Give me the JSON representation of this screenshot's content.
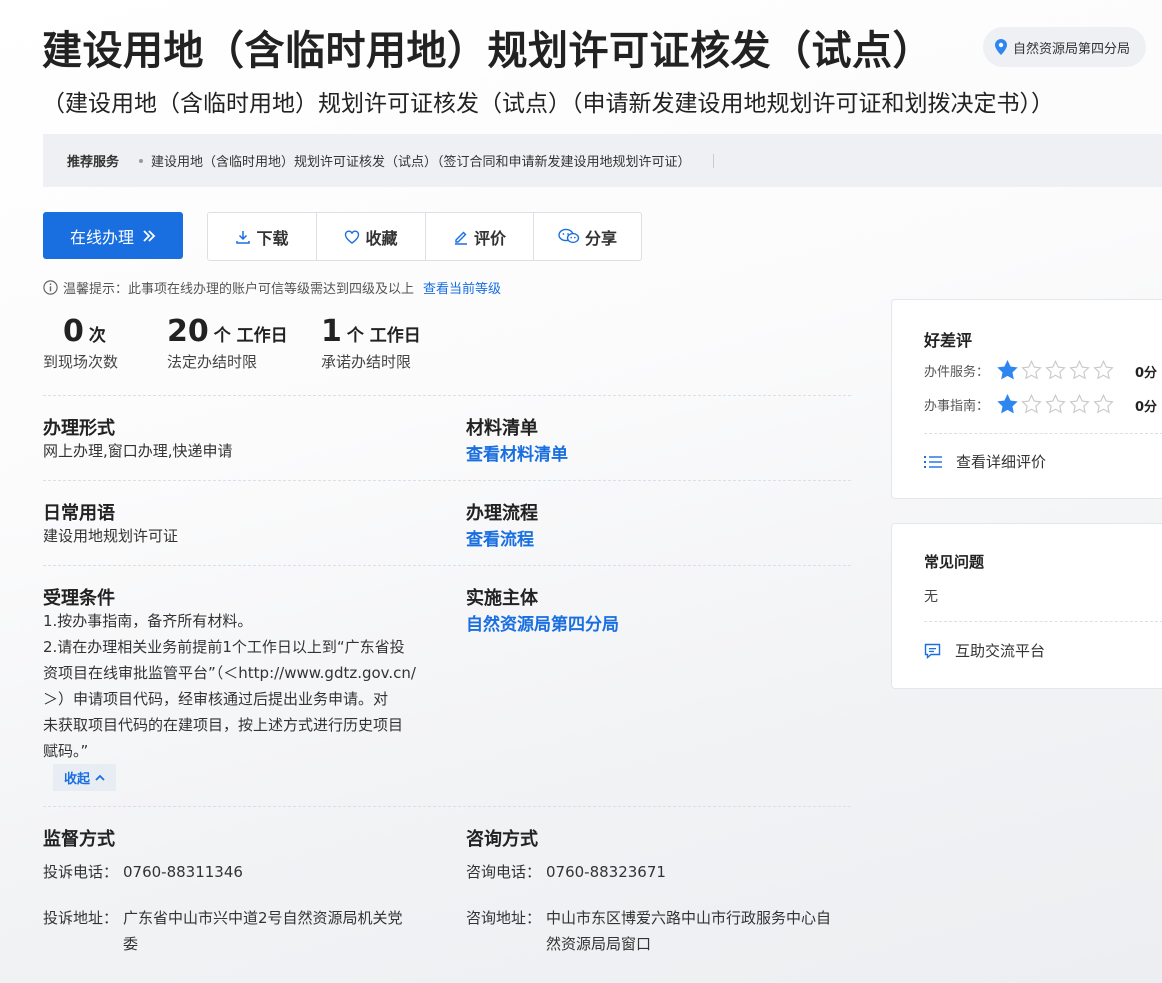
{
  "header": {
    "title": "建设用地（含临时用地）规划许可证核发（试点）",
    "subtitle": "（建设用地（含临时用地）规划许可证核发（试点）（申请新发建设用地规划许可证和划拨决定书））",
    "location": "自然资源局第四分局",
    "location_icon": "location-pin-icon"
  },
  "recommend": {
    "label": "推荐服务",
    "items": [
      "建设用地（含临时用地）规划许可证核发（试点）（签订合同和申请新发建设用地规划许可证）"
    ]
  },
  "actions": {
    "online": "在线办理",
    "online_icon": "double-chevron-right-icon",
    "download": "下载",
    "favorite": "收藏",
    "review": "评价",
    "share": "分享"
  },
  "tip": {
    "text": "温馨提示：此事项在线办理的账户可信等级需达到四级及以上",
    "link": "查看当前等级"
  },
  "stats": [
    {
      "value": "0",
      "unit": "次",
      "label": "到现场次数"
    },
    {
      "value": "20",
      "unit": "个 工作日",
      "label": "法定办结时限"
    },
    {
      "value": "1",
      "unit": "个 工作日",
      "label": "承诺办结时限"
    }
  ],
  "details": {
    "form": {
      "title": "办理形式",
      "value": "网上办理,窗口办理,快递申请"
    },
    "materials": {
      "title": "材料清单",
      "link": "查看材料清单"
    },
    "common_term": {
      "title": "日常用语",
      "value": "建设用地规划许可证"
    },
    "process": {
      "title": "办理流程",
      "link": "查看流程"
    },
    "conditions": {
      "title": "受理条件",
      "lines": [
        "1.按办事指南，备齐所有材料。",
        "2.请在办理相关业务前提前1个工作日以上到“广东省投",
        "资项目在线审批监管平台”（＜http://www.gdtz.gov.cn/",
        "＞）申请项目代码，经审核通过后提出业务申请。对",
        "未获取项目代码的在建项目，按上述方式进行历史项目",
        "赋码。”"
      ],
      "collapse": "收起"
    },
    "subject": {
      "title": "实施主体",
      "link": "自然资源局第四分局"
    },
    "supervision": {
      "title": "监督方式",
      "phone_label": "投诉电话：",
      "phone": "0760-88311346",
      "address_label": "投诉地址：",
      "address_lines": [
        "广东省中山市兴中道2号自然资源局机关党",
        "委"
      ]
    },
    "consult": {
      "title": "咨询方式",
      "phone_label": "咨询电话：",
      "phone": "0760-88323671",
      "address_label": "咨询地址：",
      "address_lines": [
        "中山市东区博爱六路中山市行政服务中心自",
        "然资源局局窗口"
      ]
    }
  },
  "rating": {
    "title": "好差评",
    "rows": [
      {
        "label": "办件服务：",
        "stars": 1,
        "max": 5,
        "score": "0分"
      },
      {
        "label": "办事指南：",
        "stars": 1,
        "max": 5,
        "score": "0分"
      }
    ],
    "detail_link": "查看详细评价"
  },
  "faq": {
    "title": "常见问题",
    "value": "无",
    "link": "互助交流平台"
  },
  "colors": {
    "accent": "#1a6fe0",
    "star_on": "#2e86f0",
    "star_off": "#c7c9cc"
  }
}
